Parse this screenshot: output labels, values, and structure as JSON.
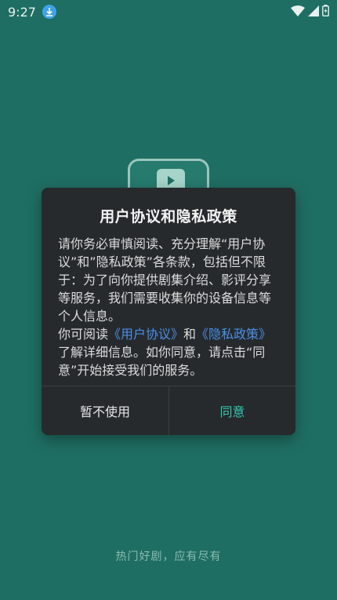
{
  "status_bar": {
    "time": "9:27"
  },
  "dialog": {
    "title": "用户协议和隐私政策",
    "body_part1": "请你务必审慎阅读、充分理解“用户协议”和”隐私政策”各条款，包括但不限于：为了向你提供剧集介绍、影评分享等服务，我们需要收集你的设备信息等个人信息。",
    "body_part2_prefix": "你可阅读",
    "user_agreement_link": "《用户协议》",
    "and_text": "和",
    "privacy_policy_link": "《隐私政策》",
    "body_part2_suffix": "了解详细信息。如你同意，请点击“同意”开始接受我们的服务。",
    "decline_label": "暂不使用",
    "agree_label": "同意"
  },
  "slogan": "热门好剧，应有尽有",
  "colors": {
    "background": "#1f6e63",
    "dialog": "#262a2c",
    "link": "#4a8fe8",
    "agree": "#34c7b0"
  }
}
